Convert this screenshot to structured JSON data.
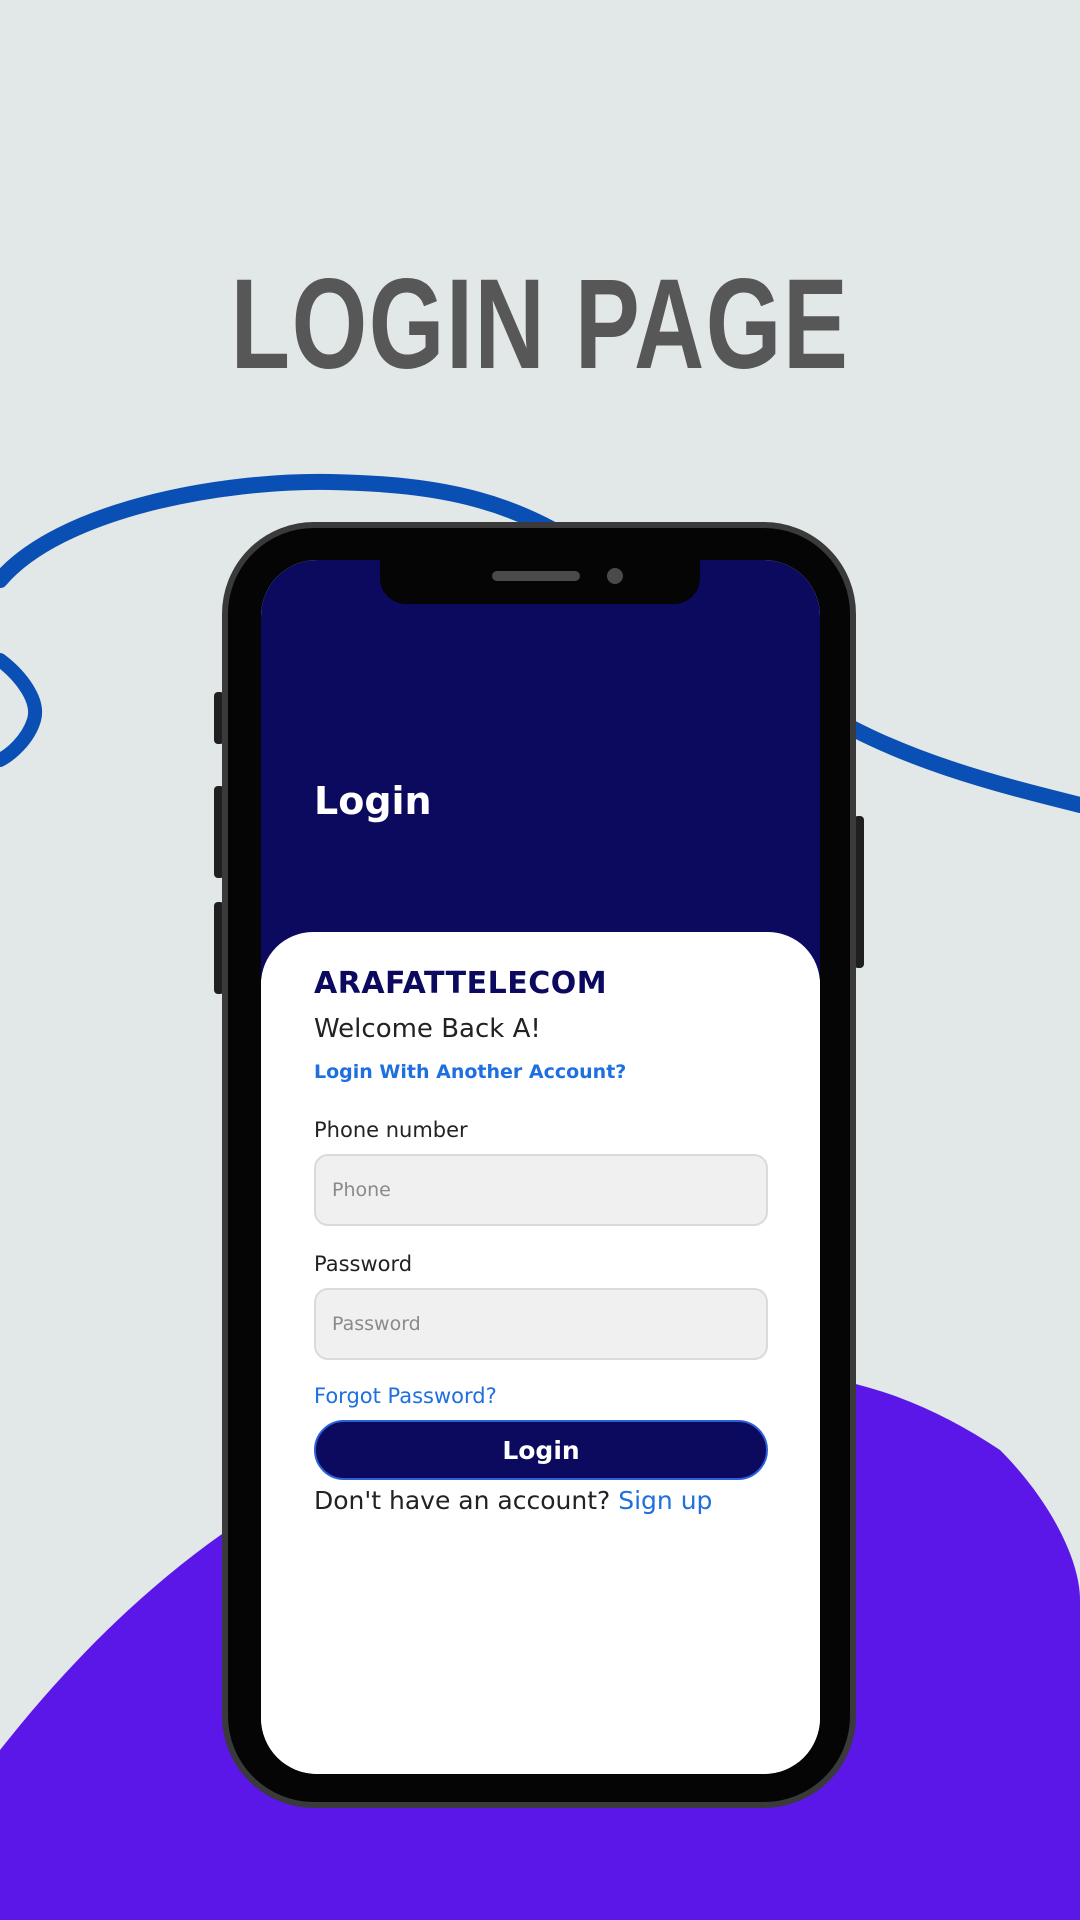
{
  "promo": {
    "title": "LOGIN PAGE"
  },
  "colors": {
    "background": "#e2e7e8",
    "swirl": "#0a4fb4",
    "blob": "#5b17e8",
    "header": "#0b0a5e",
    "link": "#1e6fe0",
    "title_text": "#575757"
  },
  "app": {
    "header_title": "Login",
    "brand": "ARAFATTELECOM",
    "welcome": "Welcome Back A!",
    "switch_account_link": "Login With Another Account?",
    "phone": {
      "label": "Phone number",
      "placeholder": "Phone",
      "value": ""
    },
    "password": {
      "label": "Password",
      "placeholder": "Password",
      "value": ""
    },
    "forgot_password_link": "Forgot Password?",
    "login_button": "Login",
    "signup_prompt": "Don't have an account?",
    "signup_link": "Sign up"
  }
}
